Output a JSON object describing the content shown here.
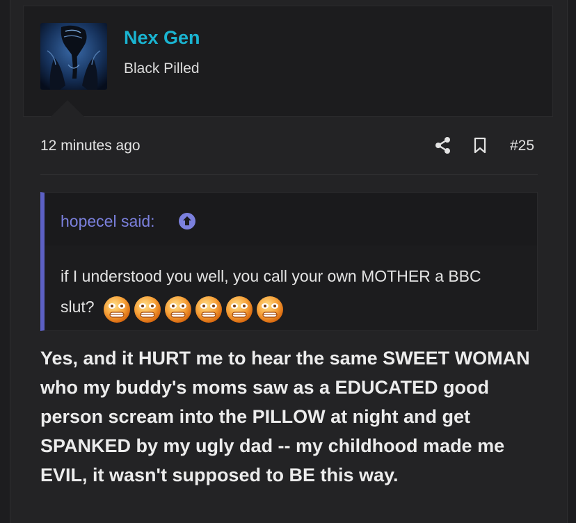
{
  "user": {
    "name": "Nex Gen",
    "title": "Black Pilled"
  },
  "meta": {
    "time": "12 minutes ago",
    "post_number": "#25"
  },
  "icons": {
    "share": "share-icon",
    "bookmark": "bookmark-icon",
    "quote_jump": "arrow-up-circle-icon"
  },
  "quote": {
    "author": "hopecel said:",
    "text": "if I understood you well, you call your own MOTHER a BBC slut?",
    "smiley_count": 6
  },
  "reply": {
    "text": "Yes, and it HURT me to hear the same SWEET WOMAN who my buddy's moms saw as a EDUCATED good person scream into the PILLOW at night and get SPANKED by my ugly dad -- my childhood made me EVIL, it wasn't supposed to BE this way."
  },
  "colors": {
    "username": "#1ab4d1",
    "quote_accent": "#5c60c4",
    "quote_author": "#7b80dd"
  }
}
